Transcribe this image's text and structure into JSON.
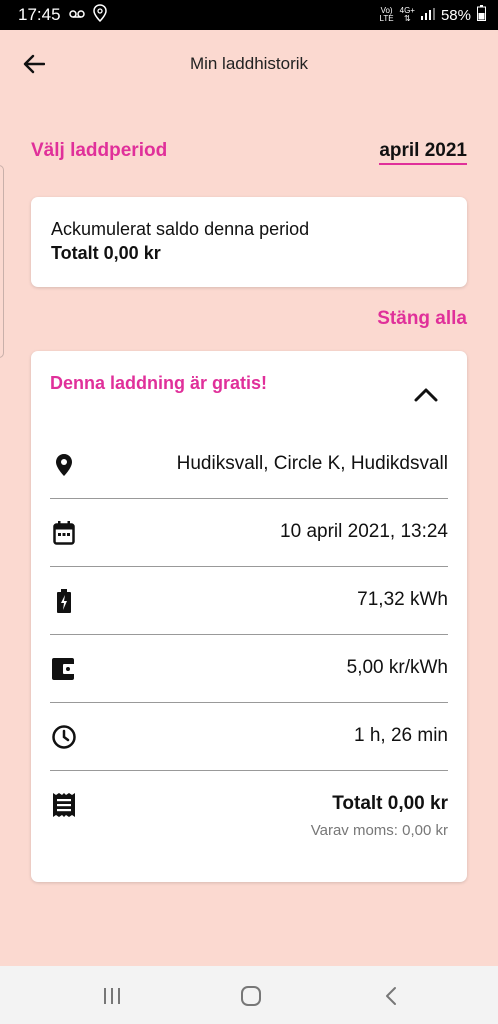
{
  "status_bar": {
    "time": "17:45",
    "network_top": "Vo)",
    "network_bottom": "LTE",
    "signal_top": "4G+",
    "battery_percent": "58%"
  },
  "header": {
    "title": "Min laddhistorik",
    "back_icon": "arrow-left-icon"
  },
  "period": {
    "label": "Välj laddperiod",
    "value": "april 2021"
  },
  "saldo": {
    "title": "Ackumulerat saldo denna period",
    "total": "Totalt 0,00 kr"
  },
  "close_all_label": "Stäng alla",
  "session": {
    "status": "Denna laddning är gratis!",
    "location": "Hudiksvall, Circle K, Hudikdsvall",
    "datetime": "10 april 2021, 13:24",
    "energy": "71,32 kWh",
    "price": "5,00 kr/kWh",
    "duration": "1 h, 26 min",
    "total": "Totalt 0,00 kr",
    "vat": "Varav moms: 0,00 kr"
  },
  "colors": {
    "background": "#fbd9d0",
    "accent": "#e0309a",
    "card": "#ffffff"
  }
}
